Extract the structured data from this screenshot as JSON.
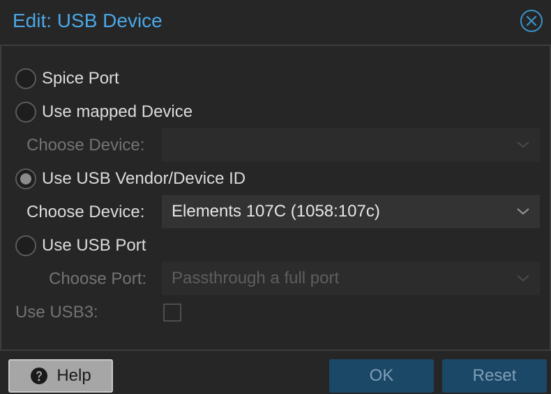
{
  "window": {
    "title": "Edit: USB Device"
  },
  "options": {
    "spice_port": {
      "label": "Spice Port",
      "checked": false
    },
    "mapped_device": {
      "label": "Use mapped Device",
      "checked": false,
      "field_label": "Choose Device:",
      "value": ""
    },
    "vendor_device_id": {
      "label": "Use USB Vendor/Device ID",
      "checked": true,
      "field_label": "Choose Device:",
      "value": "Elements 107C (1058:107c)"
    },
    "usb_port": {
      "label": "Use USB Port",
      "checked": false,
      "field_label": "Choose Port:",
      "placeholder": "Passthrough a full port"
    }
  },
  "usb3": {
    "label": "Use USB3:",
    "checked": false
  },
  "footer": {
    "help_label": "Help",
    "ok_label": "OK",
    "reset_label": "Reset"
  },
  "icons": {
    "close": "close-icon",
    "help": "question-circle-icon",
    "dropdown": "chevron-down-icon"
  },
  "colors": {
    "accent": "#4aa7e6",
    "primary_button": "#1c4868",
    "background": "#262626"
  }
}
